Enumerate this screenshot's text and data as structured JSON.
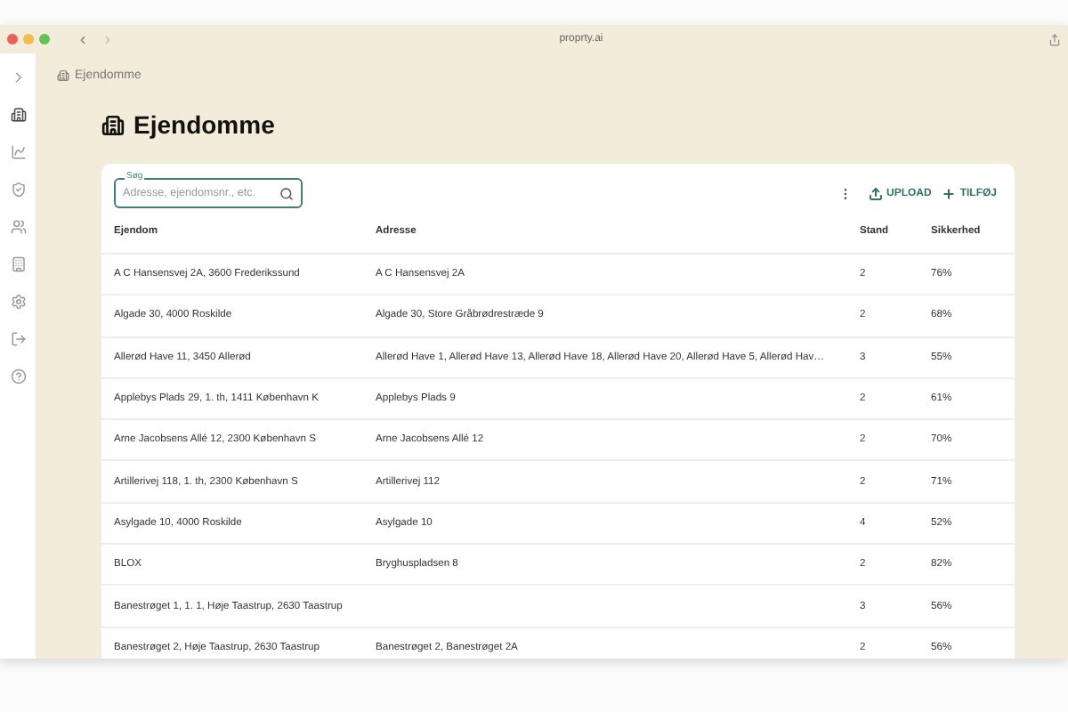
{
  "browser": {
    "url": "proprty.ai"
  },
  "sidebar": {
    "items": [
      {
        "kind": "expand",
        "selected": false
      },
      {
        "kind": "buildings",
        "selected": true
      },
      {
        "kind": "chart",
        "selected": false
      },
      {
        "kind": "shield",
        "selected": false
      },
      {
        "kind": "people",
        "selected": false
      },
      {
        "kind": "office",
        "selected": false
      },
      {
        "kind": "settings",
        "selected": false
      },
      {
        "kind": "logout",
        "selected": false
      },
      {
        "kind": "help",
        "selected": false
      }
    ]
  },
  "breadcrumb": "Ejendomme",
  "title": "Ejendomme",
  "search": {
    "label": "Søg",
    "placeholder": "Adresse, ejendomsnr., etc."
  },
  "actions": [
    {
      "kind": "upload",
      "label": "UPLOAD"
    },
    {
      "kind": "add",
      "label": "TILFØJ"
    }
  ],
  "table": {
    "columns": [
      "Ejendom",
      "Adresse",
      "Stand",
      "Sikkerhed"
    ],
    "rows": [
      [
        "A C Hansensvej 2A, 3600 Frederikssund",
        "A C Hansensvej 2A",
        "2",
        "76%"
      ],
      [
        "Algade 30, 4000 Roskilde",
        "Algade 30, Store Gråbrødrestræde 9",
        "2",
        "68%"
      ],
      [
        "Allerød Have 11, 3450 Allerød",
        "Allerød Have 1, Allerød Have 13, Allerød Have 18, Allerød Have 20, Allerød Have 5, Allerød Hav…",
        "3",
        "55%"
      ],
      [
        "Applebys Plads 29, 1. th, 1411 København K",
        "Applebys Plads 9",
        "2",
        "61%"
      ],
      [
        "Arne Jacobsens Allé 12, 2300 København S",
        "Arne Jacobsens Allé 12",
        "2",
        "70%"
      ],
      [
        "Artillerivej 118, 1. th, 2300 København S",
        "Artillerivej 112",
        "2",
        "71%"
      ],
      [
        "Asylgade 10, 4000 Roskilde",
        "Asylgade 10",
        "4",
        "52%"
      ],
      [
        "BLOX",
        "Bryghuspladsen 8",
        "2",
        "82%"
      ],
      [
        "Banestrøget 1, 1. 1, Høje Taastrup, 2630 Taastrup",
        "",
        "3",
        "56%"
      ],
      [
        "Banestrøget 2, Høje Taastrup, 2630 Taastrup",
        "Banestrøget 2, Banestrøget 2A",
        "2",
        "56%"
      ]
    ]
  }
}
